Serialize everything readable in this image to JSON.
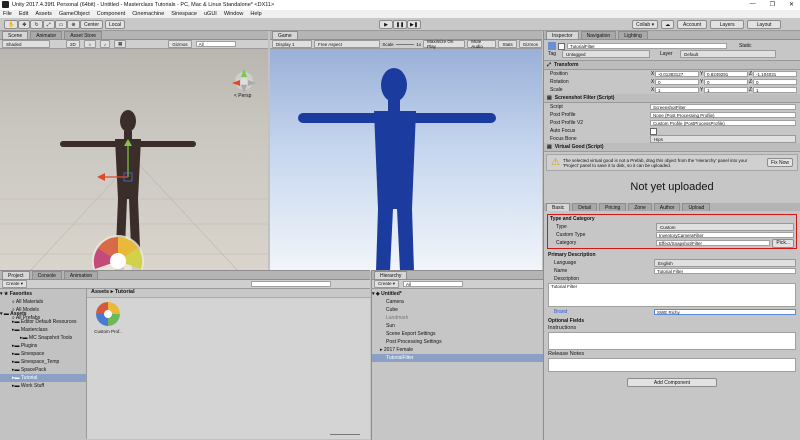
{
  "window": {
    "title": "Unity 2017.4.39f1 Personal (64bit) - Untitled - Masterclass Tutorials - PC, Mac & Linux Standalone* <DX11>",
    "min": "—",
    "max": "❐",
    "close": "✕"
  },
  "menu": [
    "File",
    "Edit",
    "Assets",
    "GameObject",
    "Component",
    "Cinemachine",
    "Sinespace",
    "uGUI",
    "Window",
    "Help"
  ],
  "toolbar": {
    "center": "Center",
    "local": "Local",
    "play": "▶",
    "pause": "❚❚",
    "step": "▶❚",
    "collab": "Collab ▾",
    "account": "Account",
    "layers": "Layers",
    "layout": "Layout"
  },
  "scene": {
    "tabs": [
      "Scene",
      "Animator",
      "Asset Store"
    ],
    "shading": "Shaded",
    "mode": "2D",
    "gizmos": "Gizmos",
    "search": "All",
    "persp": "< Persp"
  },
  "game": {
    "tab": "Game",
    "display": "Display 1",
    "aspect": "Free Aspect",
    "scale_label": "Scale",
    "scale": "1x",
    "btns": [
      "Maximize On Play",
      "Mute Audio",
      "Stats",
      "Gizmos"
    ]
  },
  "inspector": {
    "tabs": [
      "Inspector",
      "Navigation",
      "Lighting"
    ],
    "name": "TutorialFilter",
    "static": "Static",
    "tag_label": "Tag",
    "tag": "Untagged",
    "layer_label": "Layer",
    "layer": "Default",
    "transform": {
      "title": "Transform",
      "rows": [
        {
          "label": "Position",
          "x": "-0.01383127",
          "y": "0.8249291",
          "z": "-1.104031"
        },
        {
          "label": "Rotation",
          "x": "0",
          "y": "0",
          "z": "0"
        },
        {
          "label": "Scale",
          "x": "1",
          "y": "1",
          "z": "1"
        }
      ]
    },
    "screenshot": {
      "title": "Screenshot Filter (Script)",
      "rows": [
        {
          "label": "Script",
          "value": "ScreenshotFilter"
        },
        {
          "label": "Post Profile",
          "value": "None (Post Processing Profile)"
        },
        {
          "label": "Post Profile V2",
          "value": "Custom Profile (PostProcessProfile)"
        },
        {
          "label": "Auto Focus",
          "value": ""
        },
        {
          "label": "Focus Bone",
          "value": "Hips"
        }
      ]
    },
    "vgood": {
      "title": "Virtual Good (Script)",
      "warning": "The selected virtual good is not a Prefab, drag this object from the 'Hierarchy' panel into your 'Project' panel to save it to disk, so it can be uploaded.",
      "fix": "Fix Now",
      "status": "Not yet uploaded"
    },
    "subtabs": [
      "Basic",
      "Detail",
      "Pricing",
      "Zone",
      "Author",
      "Upload"
    ],
    "type_section": {
      "title": "Type and Category",
      "rows": [
        {
          "label": "Type",
          "value": "Custom"
        },
        {
          "label": "Custom Type",
          "value": "InventoryCameraFilter"
        },
        {
          "label": "Category",
          "value": "Effect/Snapshot/Filter"
        }
      ],
      "pick": "Pick..."
    },
    "primary": {
      "title": "Primary Description",
      "language_label": "Language",
      "language": "English",
      "name_label": "Name",
      "name": "Tutorial Filter",
      "desc_label": "Description",
      "desc": "Tutorial Filter",
      "brand_label": "Brand",
      "brand": "SWE Richy"
    },
    "optional": {
      "title": "Optional Fields",
      "instructions": "Instructions",
      "release": "Release Notes"
    },
    "add_component": "Add Component"
  },
  "project": {
    "tabs": [
      "Project",
      "Console",
      "Animation"
    ],
    "create": "Create ▾",
    "favorites": {
      "title": "Favorites",
      "items": [
        "All Materials",
        "All Models",
        "All Prefabs"
      ]
    },
    "assets": {
      "title": "Assets",
      "items": [
        "Editor Default Resources",
        "Masterclass",
        "MC Snapshot Tools",
        "Plugins",
        "Sinespace",
        "Sinespace_Temp",
        "SpacePack",
        "Tutorial",
        "Work Stuff"
      ]
    },
    "breadcrumb": "Assets ▸ Tutorial",
    "asset_name": "Custom Prof.."
  },
  "hierarchy": {
    "tab": "Hierarchy",
    "create": "Create ▾",
    "search": "All",
    "scene": "Untitled*",
    "items": [
      "Camera",
      "Cube",
      "Landmark",
      "Sun",
      "Scene Export Settings",
      "Post Processing Settings",
      "2017 Female",
      "TutorialFilter"
    ]
  }
}
